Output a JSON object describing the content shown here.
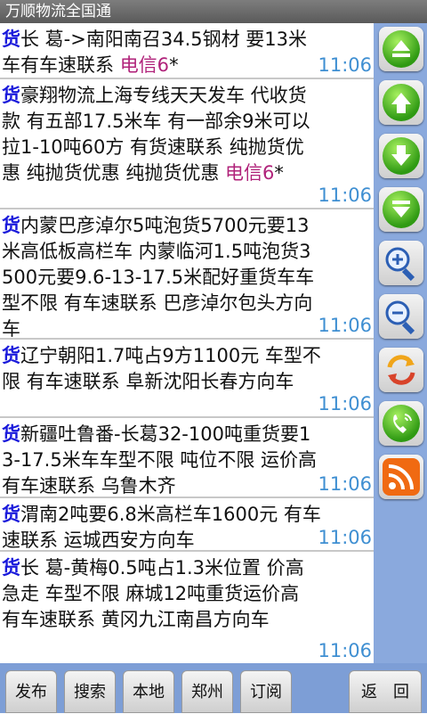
{
  "app": {
    "title": "万顺物流全国通"
  },
  "listings": [
    {
      "tag": "货",
      "body": "长 葛->南阳南召34.5钢材 要13米车有车速联系 ",
      "carrier": "电信6",
      "suffix": "*",
      "time": "11:06"
    },
    {
      "tag": "货",
      "body": "豪翔物流上海专线天天发车 代收货款 有五部17.5米车 有一部余9米可以拉1-10吨60方 有货速联系 纯抛货优惠 纯抛货优惠 纯抛货优惠 ",
      "carrier": "电信6",
      "suffix": "*",
      "time": "11:06"
    },
    {
      "tag": "货",
      "body": "内蒙巴彦淖尔5吨泡货5700元要13米高低板高栏车 内蒙临河1.5吨泡货3500元要9.6-13-17.5米配好重货车车型不限 有车速联系 巴彦淖尔包头方向车",
      "carrier": "",
      "suffix": "",
      "time": "11:06"
    },
    {
      "tag": "货",
      "body": "辽宁朝阳1.7吨占9方1100元 车型不限 有车速联系 阜新沈阳长春方向车",
      "carrier": "",
      "suffix": "",
      "time": "11:06"
    },
    {
      "tag": "货",
      "body": "新疆吐鲁番-长葛32-100吨重货要13-17.5米车车型不限 吨位不限 运价高 有车速联系 乌鲁木齐",
      "carrier": "",
      "suffix": "",
      "time": "11:06"
    },
    {
      "tag": "货",
      "body": "渭南2吨要6.8米高栏车1600元 有车速联系 运城西安方向车",
      "carrier": "",
      "suffix": "",
      "time": "11:06"
    },
    {
      "tag": "货",
      "body": "长 葛-黄梅0.5吨占1.3米位置 价高急走 车型不限 麻城12吨重货运价高 有车速联系 黄冈九江南昌方向车",
      "carrier": "",
      "suffix": "",
      "time": "11:06"
    }
  ],
  "side_icons": [
    "scroll-top-icon",
    "scroll-up-icon",
    "scroll-down-icon",
    "scroll-bottom-icon",
    "zoom-in-icon",
    "zoom-out-icon",
    "refresh-icon",
    "phone-icon",
    "rss-icon"
  ],
  "bottom_buttons": [
    "发布",
    "搜索",
    "本地",
    "郑州",
    "订阅",
    "返　回"
  ]
}
